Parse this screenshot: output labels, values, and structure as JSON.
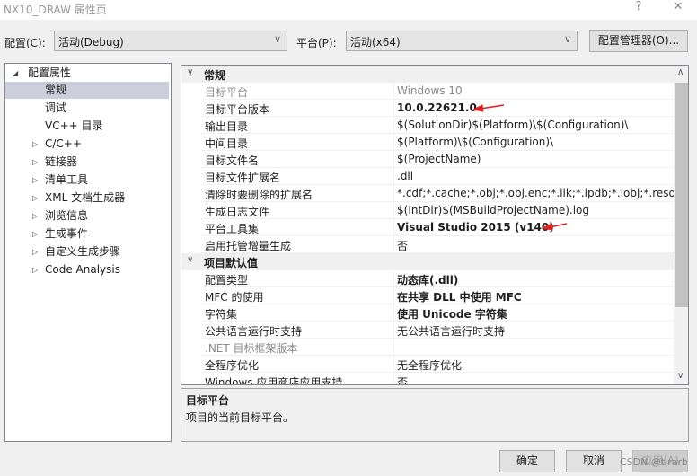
{
  "window": {
    "title": "NX10_DRAW 属性页",
    "help": "?",
    "close": "✕"
  },
  "toolbar": {
    "config_label": "配置(C):",
    "config_value": "活动(Debug)",
    "platform_label": "平台(P):",
    "platform_value": "活动(x64)",
    "config_manager": "配置管理器(O)..."
  },
  "tree": {
    "root": "配置属性",
    "items": [
      {
        "label": "常规",
        "expandable": false,
        "selected": true
      },
      {
        "label": "调试",
        "expandable": false
      },
      {
        "label": "VC++ 目录",
        "expandable": false
      },
      {
        "label": "C/C++",
        "expandable": true
      },
      {
        "label": "链接器",
        "expandable": true
      },
      {
        "label": "清单工具",
        "expandable": true
      },
      {
        "label": "XML 文档生成器",
        "expandable": true
      },
      {
        "label": "浏览信息",
        "expandable": true
      },
      {
        "label": "生成事件",
        "expandable": true
      },
      {
        "label": "自定义生成步骤",
        "expandable": true
      },
      {
        "label": "Code Analysis",
        "expandable": true
      }
    ]
  },
  "grid": {
    "general": {
      "title": "常规",
      "rows": [
        {
          "k": "目标平台",
          "v": "Windows 10",
          "style": "gray"
        },
        {
          "k": "目标平台版本",
          "v": "10.0.22621.0",
          "style": "bold"
        },
        {
          "k": "输出目录",
          "v": "$(SolutionDir)$(Platform)\\$(Configuration)\\"
        },
        {
          "k": "中间目录",
          "v": "$(Platform)\\$(Configuration)\\"
        },
        {
          "k": "目标文件名",
          "v": "$(ProjectName)"
        },
        {
          "k": "目标文件扩展名",
          "v": ".dll"
        },
        {
          "k": "清除时要删除的扩展名",
          "v": "*.cdf;*.cache;*.obj;*.obj.enc;*.ilk;*.ipdb;*.iobj;*.resources"
        },
        {
          "k": "生成日志文件",
          "v": "$(IntDir)$(MSBuildProjectName).log"
        },
        {
          "k": "平台工具集",
          "v": "Visual Studio 2015 (v140)",
          "style": "bold"
        },
        {
          "k": "启用托管增量生成",
          "v": "否"
        }
      ]
    },
    "defaults": {
      "title": "项目默认值",
      "rows": [
        {
          "k": "配置类型",
          "v": "动态库(.dll)",
          "style": "bold"
        },
        {
          "k": "MFC 的使用",
          "v": "在共享 DLL 中使用 MFC",
          "style": "bold"
        },
        {
          "k": "字符集",
          "v": "使用 Unicode 字符集",
          "style": "bold"
        },
        {
          "k": "公共语言运行时支持",
          "v": "无公共语言运行时支持"
        },
        {
          "k": ".NET 目标框架版本",
          "v": "",
          "style": "graykey"
        },
        {
          "k": "全程序优化",
          "v": "无全程序优化"
        },
        {
          "k": "Windows 应用商店应用支持",
          "v": "否"
        }
      ]
    }
  },
  "description": {
    "title": "目标平台",
    "text": "项目的当前目标平台。"
  },
  "buttons": {
    "ok": "确定",
    "cancel": "取消",
    "apply": "应用(A)"
  },
  "watermark": "CSDN @tlrarb",
  "annotation_color": "#e02020"
}
